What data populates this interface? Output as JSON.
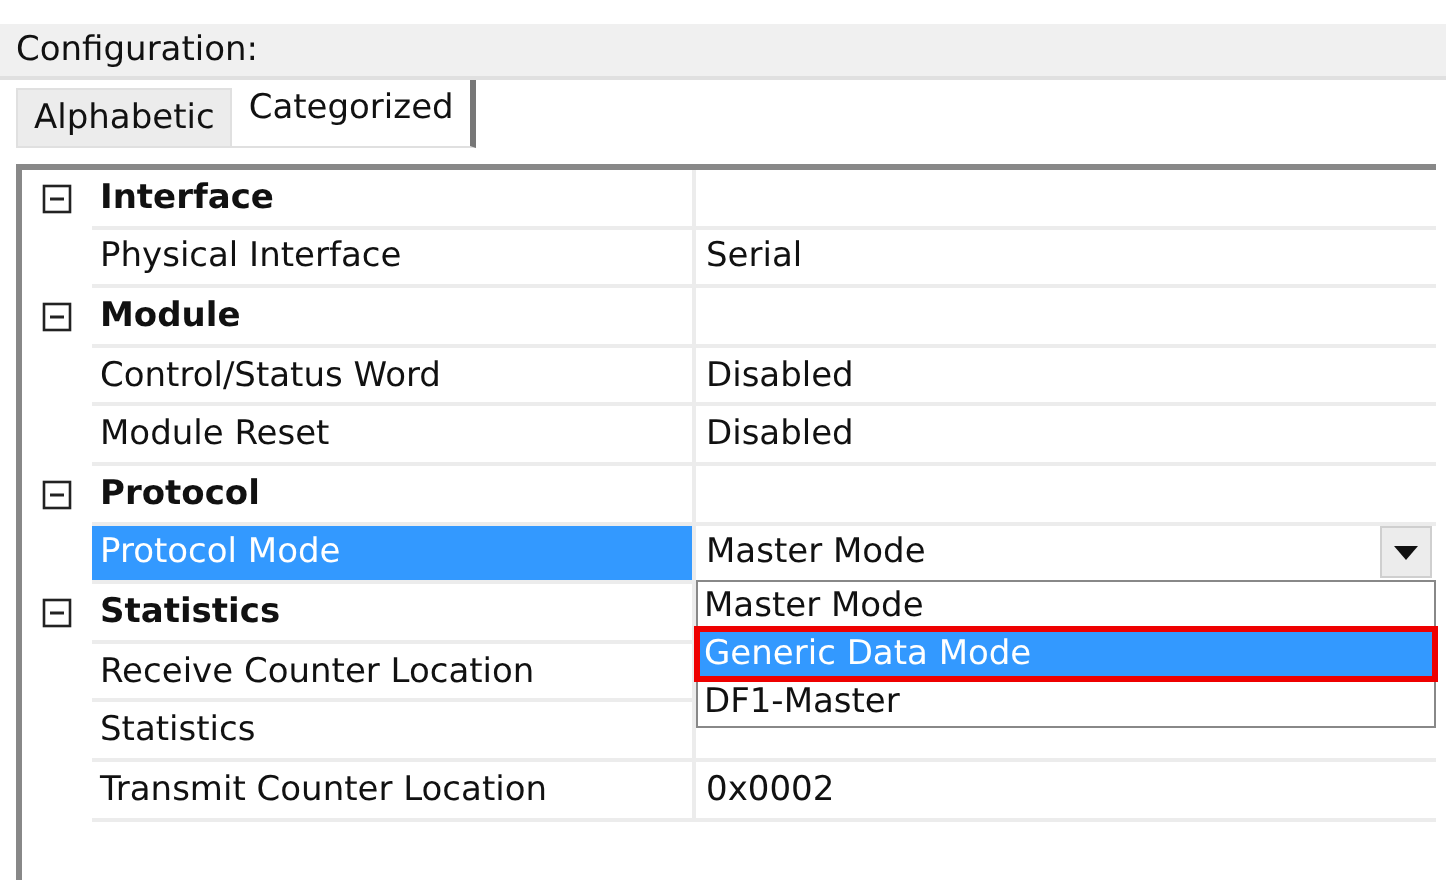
{
  "header": {
    "title": "Configuration:"
  },
  "tabs": [
    {
      "label": "Alphabetic",
      "selected": false
    },
    {
      "label": "Categorized",
      "selected": true
    }
  ],
  "categories": [
    {
      "name": "Interface",
      "expanded": true,
      "properties": [
        {
          "name": "Physical Interface",
          "value": "Serial",
          "selected": false
        }
      ]
    },
    {
      "name": "Module",
      "expanded": true,
      "properties": [
        {
          "name": "Control/Status Word",
          "value": "Disabled",
          "selected": false
        },
        {
          "name": "Module Reset",
          "value": "Disabled",
          "selected": false
        }
      ]
    },
    {
      "name": "Protocol",
      "expanded": true,
      "properties": [
        {
          "name": "Protocol Mode",
          "value": "Master Mode",
          "selected": true,
          "dropdown": {
            "options": [
              {
                "label": "Master Mode",
                "selected": false,
                "annotated": false
              },
              {
                "label": "Generic Data Mode",
                "selected": true,
                "annotated": true
              },
              {
                "label": "DF1-Master",
                "selected": false,
                "annotated": false
              }
            ]
          }
        }
      ]
    },
    {
      "name": "Statistics",
      "expanded": true,
      "properties": [
        {
          "name": "Receive Counter Location",
          "selected": false
        },
        {
          "name": "Statistics",
          "selected": false
        },
        {
          "name": "Transmit Counter Location",
          "value": "0x0002",
          "selected": false
        }
      ]
    }
  ]
}
